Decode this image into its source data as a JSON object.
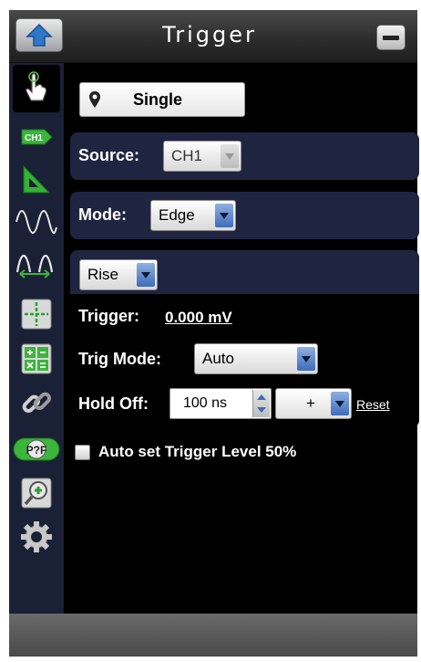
{
  "header": {
    "title": "Trigger"
  },
  "sidebar": {
    "icons": [
      "touch-hand-icon",
      "channel-ch1-icon",
      "measure-triangle-icon",
      "sine-wave-icon",
      "waveform-cursor-icon",
      "crosshair-icon",
      "math-icon",
      "link-icon",
      "pass-fail-icon",
      "zoom-icon",
      "settings-icon"
    ],
    "ch1_badge": "CH1",
    "passfail_badge": "P?F"
  },
  "trigger_type": {
    "value": "Single"
  },
  "source": {
    "label": "Source:",
    "value": "CH1"
  },
  "mode": {
    "label": "Mode:",
    "value": "Edge"
  },
  "edge": {
    "slope": "Rise",
    "trigger_label": "Trigger:",
    "trigger_value": "0.000 mV",
    "trig_mode_label": "Trig Mode:",
    "trig_mode_value": "Auto",
    "hold_off_label": "Hold Off:",
    "hold_off_value": "100 ns",
    "step_value": "+",
    "reset_label": "Reset"
  },
  "auto_level": {
    "label": "Auto set Trigger Level 50%",
    "checked": false
  }
}
